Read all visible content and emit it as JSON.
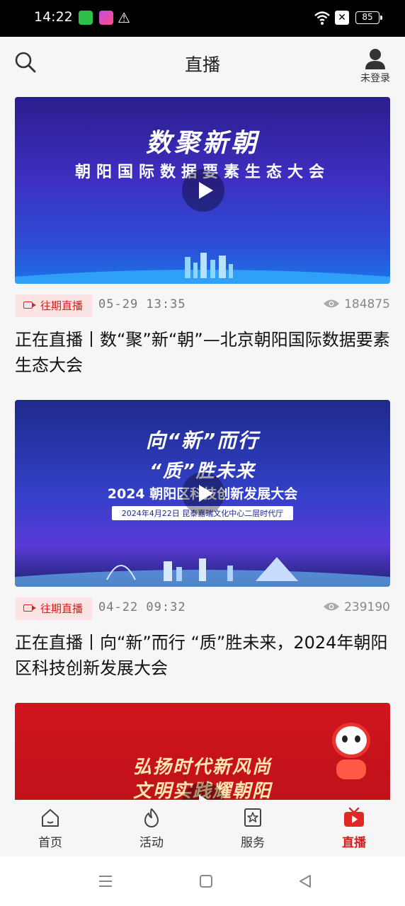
{
  "status_bar": {
    "time": "14:22",
    "battery": "85"
  },
  "header": {
    "title": "直播",
    "user_label": "未登录"
  },
  "posts": [
    {
      "thumb_title": "数聚新朝",
      "thumb_subtitle": "朝阳国际数据要素生态大会",
      "badge": "往期直播",
      "date": "05-29  13:35",
      "views": "184875",
      "title": "正在直播丨数“聚”新“朝”—北京朝阳国际数据要素生态大会"
    },
    {
      "thumb_title": "向“新”而行",
      "thumb_subtitle": "“质”胜未来",
      "thumb_line3": "2024 朝阳区科技创新发展大会",
      "thumb_line4": "2024年4月22日 昆泰嘉瑞文化中心二层时代厅",
      "badge": "往期直播",
      "date": "04-22  09:32",
      "views": "239190",
      "title": "正在直播丨向“新”而行 “质”胜未来，2024年朝阳区科技创新发展大会"
    },
    {
      "thumb_title": "弘扬时代新风尚",
      "thumb_subtitle": "文明实践耀朝阳"
    }
  ],
  "bottom_nav": [
    {
      "label": "首页",
      "icon": "home-icon"
    },
    {
      "label": "活动",
      "icon": "activity-icon"
    },
    {
      "label": "服务",
      "icon": "service-icon"
    },
    {
      "label": "直播",
      "icon": "live-tv-icon"
    }
  ],
  "colors": {
    "accent": "#d41e1e",
    "badge_bg": "#fde4e4"
  }
}
